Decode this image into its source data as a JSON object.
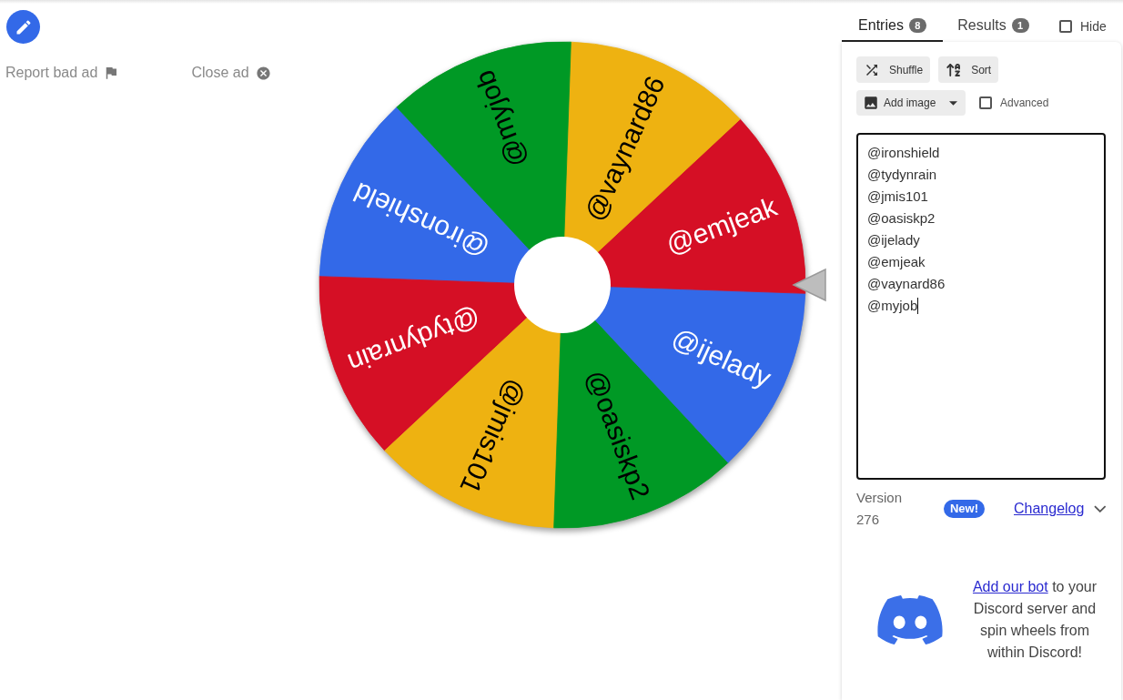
{
  "ad_bar": {
    "report_label": "Report bad ad",
    "close_label": "Close ad"
  },
  "wheel": {
    "segments": [
      {
        "label": "@ironshield",
        "color": "#3369e8"
      },
      {
        "label": "@tydynrain",
        "color": "#d50f25"
      },
      {
        "label": "@jmis101",
        "color": "#eeb211"
      },
      {
        "label": "@oasiskp2",
        "color": "#009925"
      },
      {
        "label": "@ijelady",
        "color": "#3369e8"
      },
      {
        "label": "@emjeak",
        "color": "#d50f25"
      },
      {
        "label": "@vaynard86",
        "color": "#eeb211"
      },
      {
        "label": "@myjob",
        "color": "#009925"
      }
    ]
  },
  "tabs": [
    {
      "label": "Entries",
      "count": "8",
      "selected": true
    },
    {
      "label": "Results",
      "count": "1",
      "selected": false
    }
  ],
  "hide_checkbox": {
    "label": "Hide",
    "checked": false
  },
  "buttons": [
    {
      "label": "Shuffle",
      "kind": "shuffle"
    },
    {
      "label": "Sort",
      "kind": "sort"
    }
  ],
  "add_image_button": {
    "label": "Add image"
  },
  "advanced_checkbox": {
    "label": "Advanced",
    "checked": false
  },
  "entries_field": {
    "lines": [
      "@ironshield",
      "@tydynrain",
      "@jmis101",
      "@oasiskp2",
      "@ijelady",
      "@emjeak",
      "@vaynard86",
      "@myjob"
    ],
    "focused": true
  },
  "version": {
    "label": "Version 276",
    "badge": "New!",
    "changelog_link": "Changelog"
  },
  "discord_promo": {
    "link": "Add our bot",
    "text": "to your Discord server and spin wheels from within Discord!"
  }
}
